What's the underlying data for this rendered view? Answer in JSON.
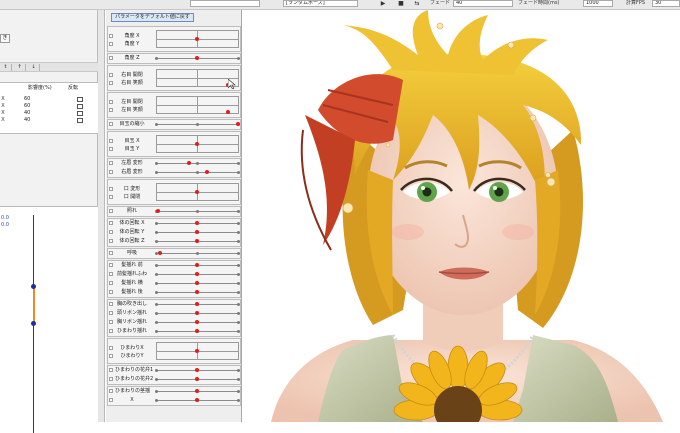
{
  "toolbar": {
    "combo_text": "[ランダムポーズ]",
    "fade_label": "フェード",
    "fade_value": "40",
    "time_label": "フェード時間(ms)",
    "time_value": "1000",
    "fps_label": "計算FPS",
    "fps_value": "30",
    "play_icon": "play-icon"
  },
  "left_panel": {
    "buttons": [
      "き",
      "↑",
      "↓"
    ],
    "tabs": [
      "t",
      "↑",
      "↓"
    ],
    "headers": {
      "influence": "影響度(%)",
      "invert": "反転"
    },
    "rows": [
      {
        "x": "X",
        "value": "60"
      },
      {
        "x": "X",
        "value": "60"
      },
      {
        "x": "X",
        "value": "40"
      },
      {
        "x": "X",
        "value": "40"
      }
    ],
    "graph": {
      "top_value": "0.0",
      "second_value": "0.0"
    }
  },
  "param_panel": {
    "reset_label": "パラメータをデフォルト値に戻す",
    "groups": [
      {
        "labels": [
          "角度 X",
          "角度 Y"
        ],
        "type": "2d"
      },
      {
        "labels": [
          "角度 Z"
        ],
        "type": "1d"
      },
      {
        "labels": [
          "右目 開閉",
          "右目 笑顔"
        ],
        "type": "2d"
      },
      {
        "labels": [
          "左目 開閉",
          "左目 笑顔"
        ],
        "type": "2d"
      },
      {
        "labels": [
          "目玉の縮小"
        ],
        "type": "1d"
      },
      {
        "labels": [
          "目玉 X",
          "目玉 Y"
        ],
        "type": "2d"
      },
      {
        "labels": [
          "左眉 変形",
          "右眉 変形"
        ],
        "type": "1d"
      },
      {
        "labels": [
          "口 変形",
          "口 開閉"
        ],
        "type": "2d"
      },
      {
        "labels": [
          "照れ"
        ],
        "type": "1d"
      },
      {
        "labels": [
          "体の回転 X",
          "体の回転 Y",
          "体の回転 Z"
        ],
        "type": "1d"
      },
      {
        "labels": [
          "呼吸"
        ],
        "type": "1d"
      },
      {
        "labels": [
          "髪揺れ 前",
          "前髪揺れふわ",
          "髪揺れ 横",
          "髪揺れ 後"
        ],
        "type": "1d"
      },
      {
        "labels": [
          "胸の吹き出し",
          "頭リボン揺れ",
          "胸リボン揺れ",
          "ひまわり揺れ"
        ],
        "type": "1d"
      },
      {
        "labels": [
          "ひまわりX",
          "ひまわりY"
        ],
        "type": "2d"
      },
      {
        "labels": [
          "ひまわりの花弁1",
          "ひまわりの花弁2"
        ],
        "type": "1d"
      },
      {
        "labels": [
          "ひまわりの茎揺",
          "X"
        ],
        "type": "1d"
      }
    ]
  },
  "colors": {
    "accent_red": "#e31d1d",
    "graph_blue": "#1d2fa0",
    "graph_orange": "#f08a24",
    "hair": "#e9b724",
    "ribbon": "#d24b2c"
  },
  "canvas": {
    "subject": "girl-with-sunflower-illustration"
  }
}
